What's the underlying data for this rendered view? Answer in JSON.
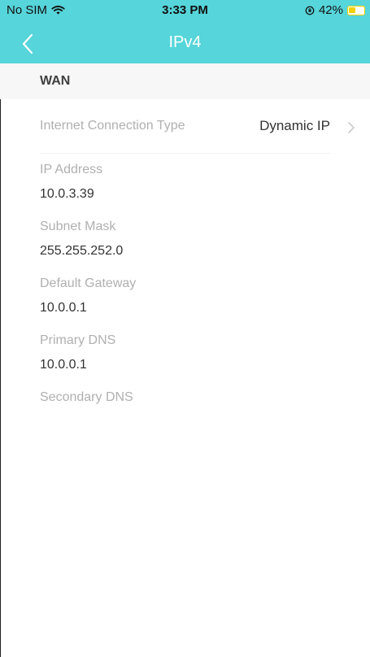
{
  "status_bar": {
    "carrier": "No SIM",
    "time": "3:33 PM",
    "battery": "42%",
    "battery_level": 0.42,
    "battery_color": "#f6d200"
  },
  "nav_bar": {
    "title": "IPv4",
    "background_color": "#56d5da",
    "back_icon": "chevron-left-icon"
  },
  "section": {
    "title": "WAN"
  },
  "connection": {
    "label": "Internet Connection Type",
    "value": "Dynamic IP",
    "icon": "chevron-right-icon"
  },
  "fields": [
    {
      "label": "IP Address",
      "value": "10.0.3.39"
    },
    {
      "label": "Subnet Mask",
      "value": "255.255.252.0"
    },
    {
      "label": "Default Gateway",
      "value": "10.0.0.1"
    },
    {
      "label": "Primary DNS",
      "value": "10.0.0.1"
    },
    {
      "label": "Secondary DNS",
      "value": ""
    }
  ]
}
